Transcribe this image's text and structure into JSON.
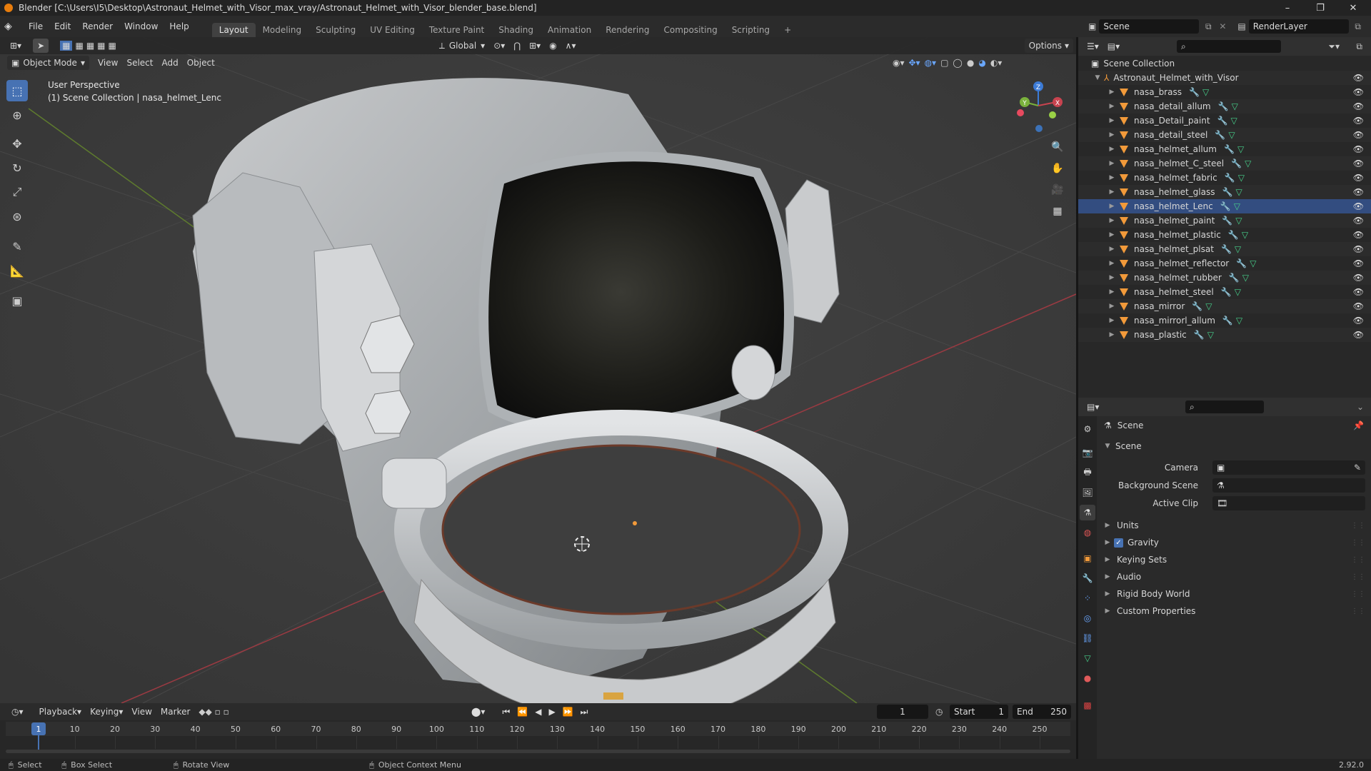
{
  "window": {
    "title": "Blender [C:\\Users\\I5\\Desktop\\Astronaut_Helmet_with_Visor_max_vray/Astronaut_Helmet_with_Visor_blender_base.blend]",
    "minimize": "–",
    "maximize": "❐",
    "close": "✕"
  },
  "menu": [
    "File",
    "Edit",
    "Render",
    "Window",
    "Help"
  ],
  "workspaces": [
    {
      "label": "Layout",
      "active": true
    },
    {
      "label": "Modeling"
    },
    {
      "label": "Sculpting"
    },
    {
      "label": "UV Editing"
    },
    {
      "label": "Texture Paint"
    },
    {
      "label": "Shading"
    },
    {
      "label": "Animation"
    },
    {
      "label": "Rendering"
    },
    {
      "label": "Compositing"
    },
    {
      "label": "Scripting"
    }
  ],
  "add_workspace": "+",
  "scene": {
    "name": "Scene",
    "view_layer": "RenderLayer"
  },
  "viewport": {
    "mode": "Object Mode",
    "menus": [
      "View",
      "Select",
      "Add",
      "Object"
    ],
    "transform_orientation": "Global",
    "options": "Options",
    "overlay_line1": "User Perspective",
    "overlay_line2": "(1) Scene Collection | nasa_helmet_Lenc",
    "gizmo": {
      "x": "X",
      "y": "Y",
      "z": "Z"
    }
  },
  "outliner": {
    "root": "Scene Collection",
    "collection": "Astronaut_Helmet_with_Visor",
    "selected": "nasa_helmet_Lenc",
    "objects": [
      "nasa_brass",
      "nasa_detail_allum",
      "nasa_Detail_paint",
      "nasa_detail_steel",
      "nasa_helmet_allum",
      "nasa_helmet_C_steel",
      "nasa_helmet_fabric",
      "nasa_helmet_glass",
      "nasa_helmet_Lenc",
      "nasa_helmet_paint",
      "nasa_helmet_plastic",
      "nasa_helmet_plsat",
      "nasa_helmet_reflector",
      "nasa_helmet_rubber",
      "nasa_helmet_steel",
      "nasa_mirror",
      "nasa_mirrorl_allum",
      "nasa_plastic"
    ]
  },
  "properties": {
    "context": "Scene",
    "panel": "Scene",
    "fields": [
      {
        "label": "Camera",
        "value": ""
      },
      {
        "label": "Background Scene",
        "value": ""
      },
      {
        "label": "Active Clip",
        "value": ""
      }
    ],
    "subpanels": [
      {
        "label": "Units",
        "checkbox": false
      },
      {
        "label": "Gravity",
        "checkbox": true,
        "checked": true
      },
      {
        "label": "Keying Sets",
        "checkbox": false
      },
      {
        "label": "Audio",
        "checkbox": false
      },
      {
        "label": "Rigid Body World",
        "checkbox": false
      },
      {
        "label": "Custom Properties",
        "checkbox": false
      }
    ]
  },
  "timeline": {
    "menus": [
      "Playback",
      "Keying",
      "View",
      "Marker"
    ],
    "current_frame": "1",
    "start_label": "Start",
    "start": "1",
    "end_label": "End",
    "end": "250",
    "ticks": [
      "1",
      "10",
      "20",
      "30",
      "40",
      "50",
      "60",
      "70",
      "80",
      "90",
      "100",
      "110",
      "120",
      "130",
      "140",
      "150",
      "160",
      "170",
      "180",
      "190",
      "200",
      "210",
      "220",
      "230",
      "240",
      "250"
    ]
  },
  "statusbar": {
    "items": [
      "Select",
      "Box Select",
      "Rotate View",
      "Object Context Menu"
    ],
    "version": "2.92.0"
  },
  "colors": {
    "accent": "#4772b3",
    "object_orange": "#f29a3a",
    "mesh_green": "#47d18b",
    "modifier_blue": "#6aa7ff",
    "x_axis": "#c8434f",
    "y_axis": "#7ab23c",
    "z_axis": "#3c7bd6"
  }
}
